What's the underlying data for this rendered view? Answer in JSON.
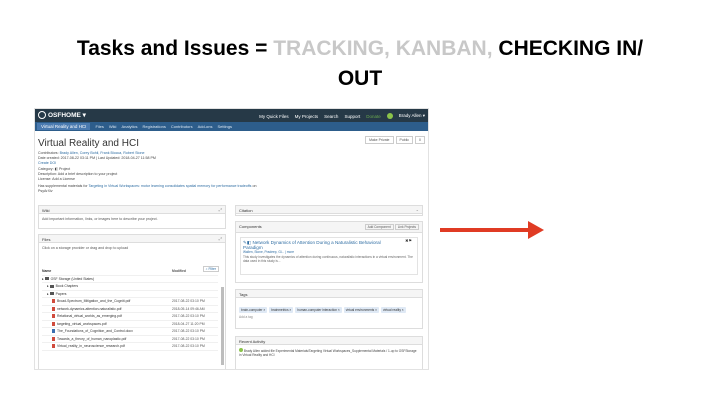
{
  "slide": {
    "title_part1": "Tasks and Issues = ",
    "title_dim": "TRACKING, KANBAN,",
    "title_part2": " CHECKING IN/",
    "title_line2": "OUT"
  },
  "colors": {
    "navbar": "#263947",
    "subnav": "#2d5d8b",
    "arrow": "#e03b24",
    "dim_text": "#c8c8c8"
  },
  "osf": {
    "brand": "OSFHOME ▾",
    "nav_links": [
      "My Quick Files",
      "My Projects",
      "Search",
      "Support",
      "Donate",
      "Brady Allen ▾"
    ],
    "subnav": {
      "project": "Virtual Reality and HCI",
      "items": [
        "Files",
        "Wiki",
        "Analytics",
        "Registrations",
        "Contributors",
        "Add-ons",
        "Settings"
      ]
    },
    "project_title": "Virtual Reality and HCI",
    "project_buttons": [
      "Make Private",
      "Public",
      "0"
    ],
    "meta": {
      "contributors_label": "Contributors:",
      "contributors": "Brady Allen, Corey Bohil, Frank Biocca, Robert Stone",
      "dates": "Date created: 2017-08-22 03:11 PM | Last Updated: 2018-04-27 11:58 PM",
      "create_doi": "Create DOI",
      "category": "Category: ◧ Project",
      "description": "Description: Add a brief description to your project",
      "license": "License: Add a License",
      "supplemental_a": "Has supplemental materials for",
      "supplemental_link": "Targeting in Virtual Workspaces: motor learning consolidates spatial memory for performance tradeoffs",
      "supplemental_b": " on PsyArXiv"
    },
    "wiki": {
      "title": "Wiki",
      "body": "Add important information, links, or images here to describe your project."
    },
    "citation": {
      "title": "Citation"
    },
    "components": {
      "title": "Components",
      "add_btn": "Add Component",
      "link_btn": "Link Projects",
      "item_title": "Network Dynamics of Attention During a Naturalistic Behavioral Paradigm",
      "item_authors": "Wallen, Stone, Pradeep, Gl... | more",
      "item_desc": "This study investigates the dynamics of attention during continuous, naturalistic interactions in a virtual environment. The data used in this study is..."
    },
    "files": {
      "title": "Files",
      "hint": "Click on a storage provider or drag and drop to upload",
      "filter": "Filter",
      "col_name": "Name",
      "col_modified": "Modified",
      "rows": [
        {
          "name": "OSF Storage (United States)",
          "date": "",
          "kind": "folder",
          "indent": 0
        },
        {
          "name": "Book Chapters",
          "date": "",
          "kind": "folder",
          "indent": 1
        },
        {
          "name": "Papers",
          "date": "",
          "kind": "folder",
          "indent": 1
        },
        {
          "name": "Broad-Spectrum_Mitigation_and_the_Cogniti.pdf",
          "date": "2017-08-22 03:10 PM",
          "kind": "pdf",
          "indent": 2
        },
        {
          "name": "network-dynamics-attention-naturalistic.pdf",
          "date": "2018-05-14 09:46 AM",
          "kind": "pdf",
          "indent": 2
        },
        {
          "name": "Relational_virtual_worlds_as_emerging.pdf",
          "date": "2017-08-22 03:10 PM",
          "kind": "pdf",
          "indent": 2
        },
        {
          "name": "targeting_virtual_workspaces.pdf",
          "date": "2018-04-27 11:20 PM",
          "kind": "pdf",
          "indent": 2
        },
        {
          "name": "The_Foundations_of_Cognition_and_Control.docx",
          "date": "2017-08-22 03:10 PM",
          "kind": "doc",
          "indent": 2
        },
        {
          "name": "Towards_a_theory_of_human_nanoplastic.pdf",
          "date": "2017-08-22 03:10 PM",
          "kind": "pdf",
          "indent": 2
        },
        {
          "name": "Virtual_reality_in_neuroscience_research.pdf",
          "date": "2017-08-22 03:10 PM",
          "kind": "pdf",
          "indent": 2
        }
      ]
    },
    "tags": {
      "title": "Tags",
      "items": [
        "brain-computer ×",
        "brainmetrics ×",
        "human-computer interaction ×",
        "virtual environments ×",
        "virtual reality ×"
      ],
      "add_tag": "Add a tag"
    },
    "activity": {
      "title": "Recent Activity",
      "entry": "Brady Allen added file Experimental Materials/Targeting Virtual Workspaces_Supplemental Materials / 1-up to OSFStorage in Virtual Reality and HCI"
    }
  }
}
